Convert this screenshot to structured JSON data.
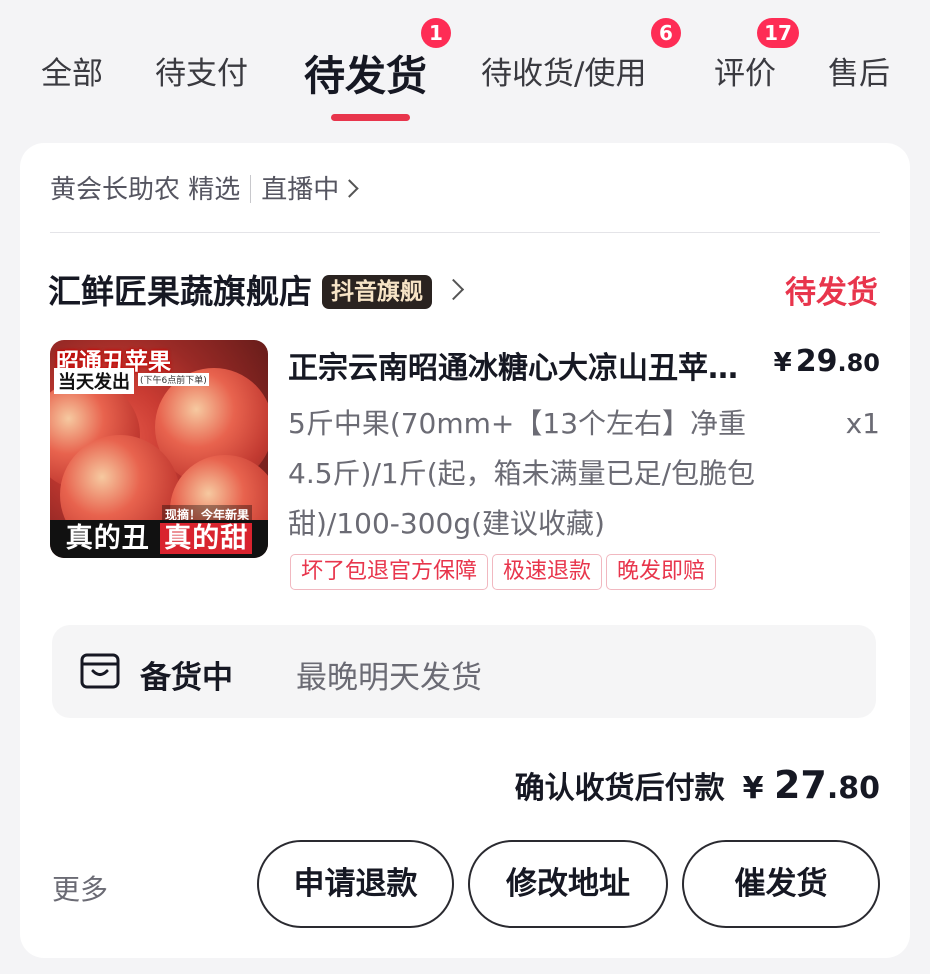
{
  "tabs": [
    {
      "label": "全部",
      "badge": ""
    },
    {
      "label": "待支付",
      "badge": ""
    },
    {
      "label": "待发货",
      "badge": "1"
    },
    {
      "label": "待收货/使用",
      "badge": "6"
    },
    {
      "label": "评价",
      "badge": "17"
    },
    {
      "label": "售后",
      "badge": ""
    }
  ],
  "active_tab": "待发货",
  "order": {
    "source": "黄会长助农 精选",
    "live_link": "直播中",
    "shop_name": "汇鲜匠果蔬旗舰店",
    "shop_tag": "抖音旗舰",
    "status": "待发货",
    "product": {
      "thumbnail_text_top": "昭通丑苹果",
      "thumbnail_text_sub": "当天发出",
      "thumbnail_text_sub2": "(下午6点前下单)",
      "thumbnail_text_new": "现摘！今年新果",
      "thumbnail_text_bottom_a": "真的丑",
      "thumbnail_text_bottom_b": "真的甜",
      "title": "正宗云南昭通冰糖心大凉山丑苹果新鲜水果",
      "price_yen": "¥",
      "price_int": "29",
      "price_dec": ".80",
      "spec": "5斤中果(70mm+【13个左右】净重4.5斤)/1斤(起，箱未满量已足/包脆包甜)/100-300g(建议收藏)",
      "quantity": "x1",
      "service_tags": [
        "坏了包退官方保障",
        "极速退款",
        "晚发即赔"
      ]
    },
    "shipping": {
      "status": "备货中",
      "note": "最晚明天发货"
    },
    "payment": {
      "label": "确认收货后付款",
      "yen": "¥",
      "amount_int": "27",
      "amount_dec": ".80"
    },
    "more_label": "更多",
    "buttons": {
      "refund": "申请退款",
      "change_address": "修改地址",
      "urge_shipping": "催发货"
    }
  },
  "colors": {
    "accent": "#fe2c55",
    "status_red": "#e8354c",
    "background": "#f4f4f6"
  }
}
